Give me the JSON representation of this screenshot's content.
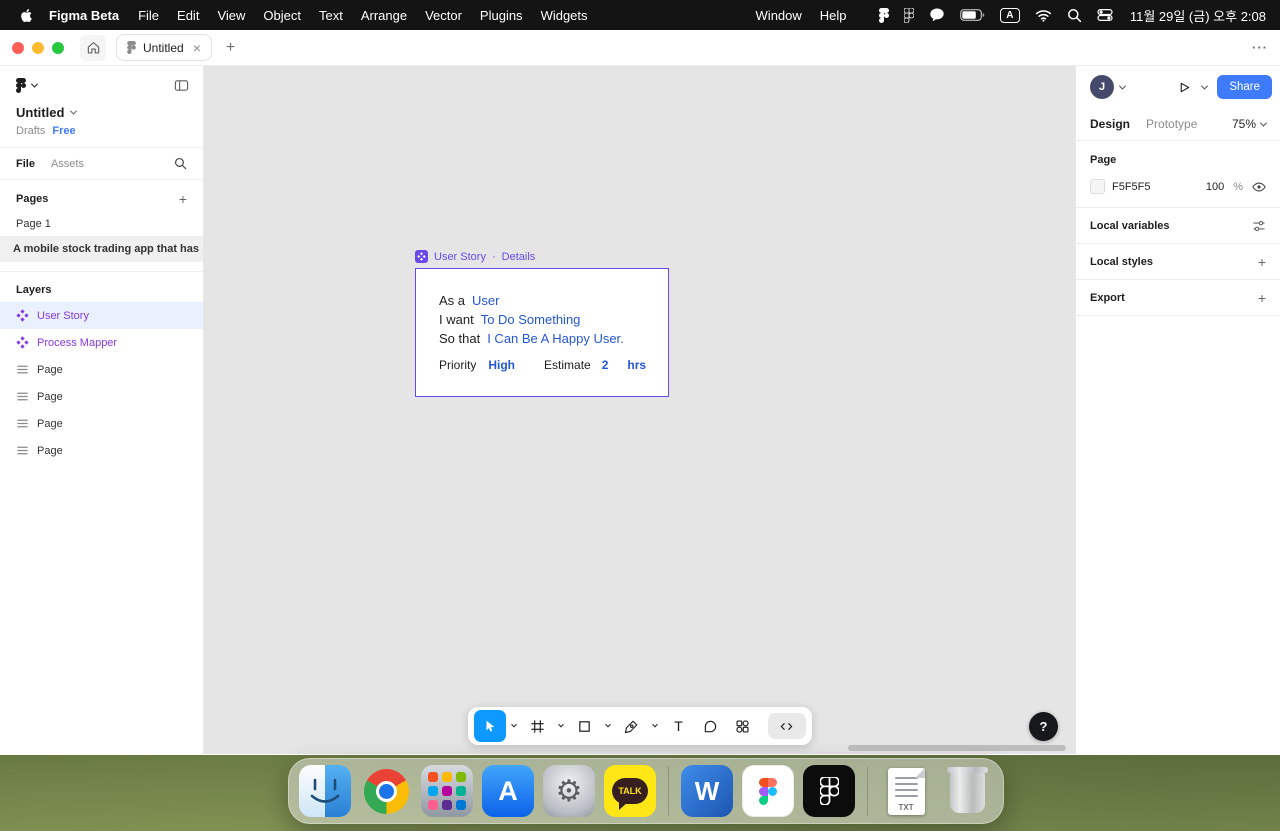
{
  "icons": {
    "close": "×",
    "plus": "+",
    "more": "···",
    "dot": "·",
    "question": "?",
    "percent": "%",
    "gear": "⚙"
  },
  "menu_bar": {
    "app_name": "Figma Beta",
    "menus": [
      "File",
      "Edit",
      "View",
      "Object",
      "Text",
      "Arrange",
      "Vector",
      "Plugins",
      "Widgets"
    ],
    "window_menu": "Window",
    "help_menu": "Help",
    "input_badge": "A",
    "clock": "11월 29일 (금) 오후 2:08"
  },
  "tab_bar": {
    "tab_title": "Untitled"
  },
  "left_sidebar": {
    "file_name": "Untitled",
    "location": "Drafts",
    "plan": "Free",
    "tab_file": "File",
    "tab_assets": "Assets",
    "pages_header": "Pages",
    "pages": [
      {
        "label": "Page 1"
      },
      {
        "label": "A mobile stock trading app that has ..."
      }
    ],
    "layers_header": "Layers",
    "layers": [
      {
        "label": "User Story"
      },
      {
        "label": "Process Mapper"
      },
      {
        "label": "Page"
      },
      {
        "label": "Page"
      },
      {
        "label": "Page"
      },
      {
        "label": "Page"
      }
    ]
  },
  "canvas": {
    "widget_name": "User Story",
    "widget_link": "Details",
    "card": {
      "rows": [
        {
          "label": "As a",
          "value": "User"
        },
        {
          "label": "I want",
          "value": "To Do Something"
        },
        {
          "label": "So that",
          "value": "I Can Be A Happy User."
        }
      ],
      "priority_label": "Priority",
      "priority_value": "High",
      "estimate_label": "Estimate",
      "estimate_value": "2",
      "estimate_unit": "hrs"
    },
    "text_tool_glyph": "T"
  },
  "right_sidebar": {
    "avatar_initial": "J",
    "share_label": "Share",
    "tab_design": "Design",
    "tab_prototype": "Prototype",
    "zoom_level": "75%",
    "page_header": "Page",
    "fill_hex": "F5F5F5",
    "fill_opacity": "100",
    "local_variables_label": "Local variables",
    "local_styles_label": "Local styles",
    "export_label": "Export"
  },
  "dock": {
    "app_store_letter": "A",
    "kakaotalk_label": "TALK",
    "word_letter": "W",
    "txt_label": "TXT"
  },
  "colors": {
    "share_blue": "#3e7bfa",
    "tool_blue": "#0d99ff",
    "widget_purple": "#6a48ea",
    "layer_purple": "#8638e5",
    "canvas_bg": "#e5e5e5",
    "fill_swatch": "#F5F5F5"
  }
}
